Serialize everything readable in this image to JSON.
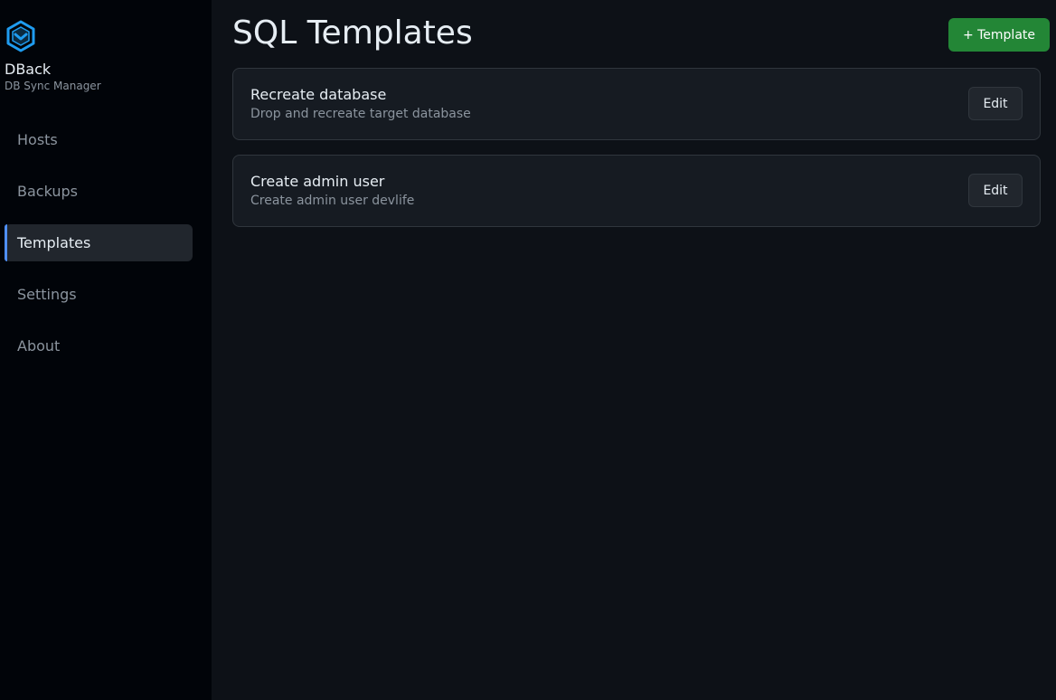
{
  "brand": {
    "name": "DBack",
    "subtitle": "DB Sync Manager",
    "logo_icon": "cube-check-icon",
    "logo_color": "#1f9cf0"
  },
  "sidebar": {
    "items": [
      {
        "label": "Hosts",
        "active": false
      },
      {
        "label": "Backups",
        "active": false
      },
      {
        "label": "Templates",
        "active": true
      },
      {
        "label": "Settings",
        "active": false
      },
      {
        "label": "About",
        "active": false
      }
    ]
  },
  "header": {
    "title": "SQL Templates",
    "add_button_label": "+ Template"
  },
  "templates": [
    {
      "title": "Recreate database",
      "description": "Drop and recreate target database",
      "edit_label": "Edit"
    },
    {
      "title": "Create admin user",
      "description": "Create admin user devlife",
      "edit_label": "Edit"
    }
  ],
  "colors": {
    "accent": "#4f8ff7",
    "primary_button": "#238636",
    "background": "#0d1117",
    "sidebar_background": "#010409"
  }
}
